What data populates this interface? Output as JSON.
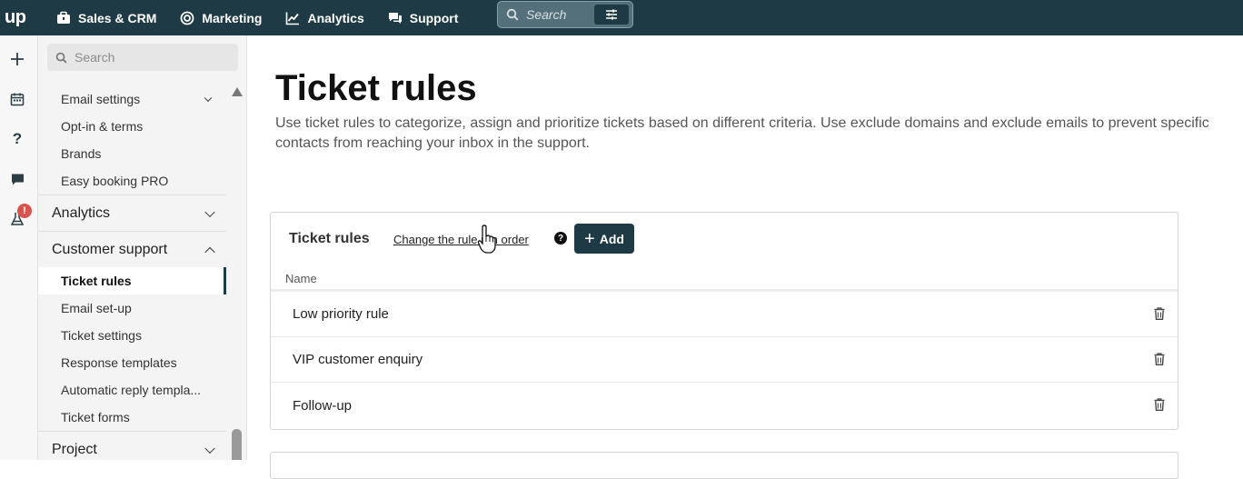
{
  "topbar": {
    "logo": "up",
    "nav": [
      {
        "label": "Sales & CRM",
        "icon": "briefcase-icon"
      },
      {
        "label": "Marketing",
        "icon": "target-icon"
      },
      {
        "label": "Analytics",
        "icon": "chart-line-icon"
      },
      {
        "label": "Support",
        "icon": "chat-bubbles-icon"
      }
    ],
    "search_placeholder": "Search"
  },
  "rail": {
    "icons": [
      "plus-icon",
      "calendar-icon",
      "help-icon",
      "chat-icon",
      "lab-icon"
    ],
    "badge": "!"
  },
  "sidebar": {
    "search_placeholder": "Search",
    "settings_items": [
      "Email settings",
      "Opt-in & terms",
      "Brands",
      "Easy booking PRO"
    ],
    "groups": {
      "analytics": "Analytics",
      "customer_support": "Customer support",
      "project": "Project"
    },
    "support_items": [
      "Ticket rules",
      "Email set-up",
      "Ticket settings",
      "Response templates",
      "Automatic reply templa...",
      "Ticket forms"
    ],
    "active_item": "Ticket rules"
  },
  "main": {
    "title": "Ticket rules",
    "description": "Use ticket rules to categorize, assign and prioritize tickets based on different criteria. Use exclude domains and exclude emails to prevent specific contacts from reaching your inbox in the support.",
    "card": {
      "title": "Ticket rules",
      "link": "Change the rule run order",
      "help": "?",
      "add_label": "Add",
      "column_name": "Name",
      "rows": [
        "Low priority rule",
        "VIP customer enquiry",
        "Follow-up"
      ]
    }
  },
  "colors": {
    "brand": "#1e3a44",
    "badge": "#d9534f"
  }
}
